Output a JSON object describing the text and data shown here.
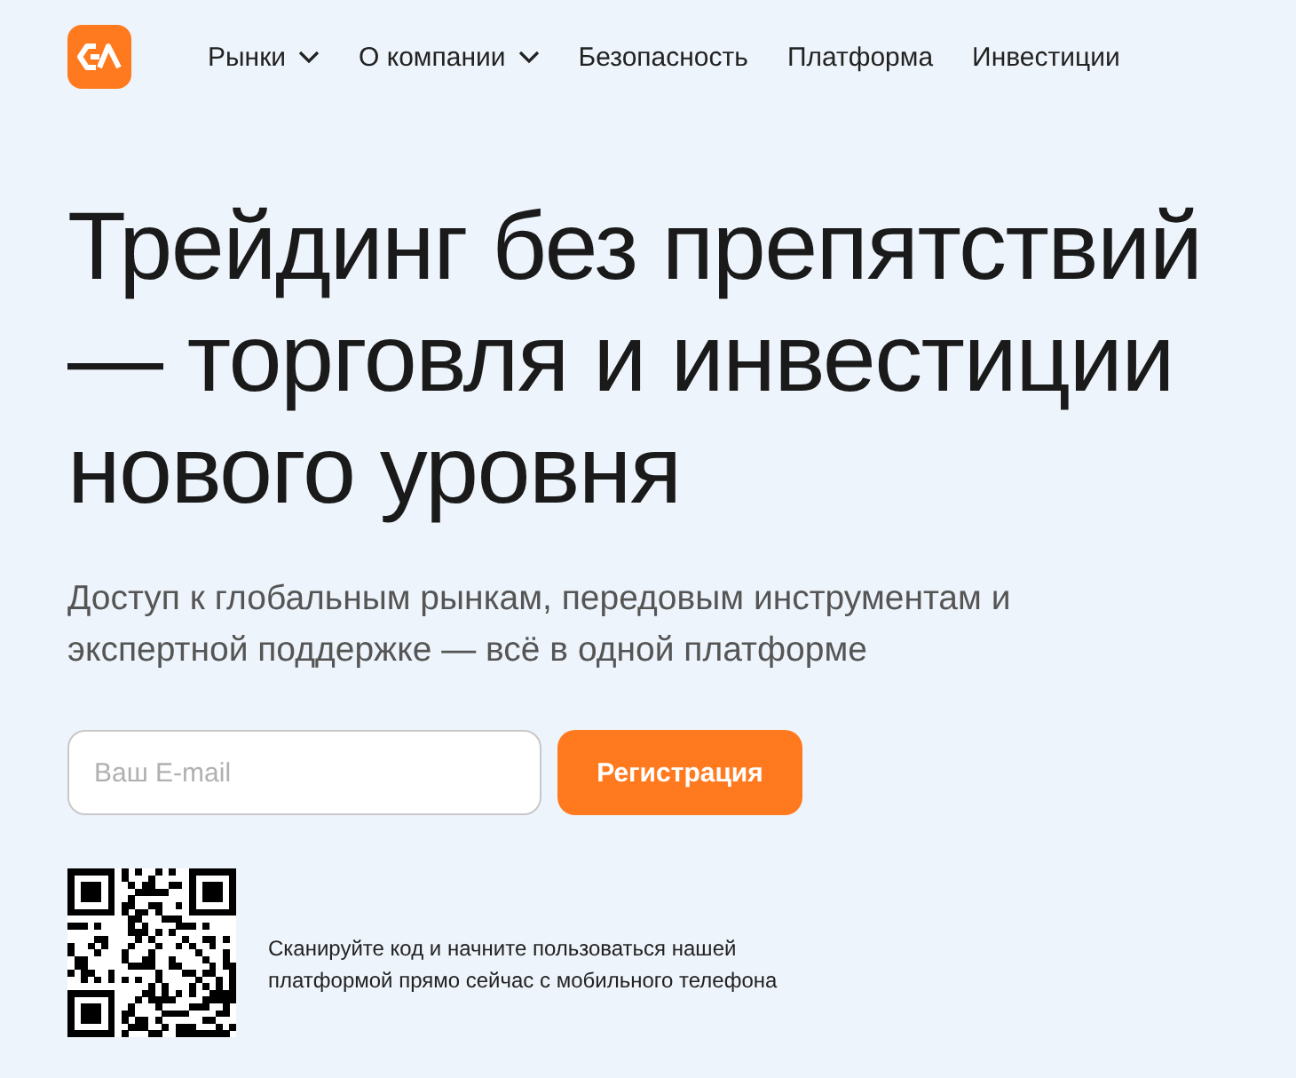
{
  "nav": [
    {
      "label": "Рынки",
      "dropdown": true
    },
    {
      "label": "О компании",
      "dropdown": true
    },
    {
      "label": "Безопасность",
      "dropdown": false
    },
    {
      "label": "Платформа",
      "dropdown": false
    },
    {
      "label": "Инвестиции",
      "dropdown": false
    }
  ],
  "hero": {
    "title": "Трейдинг без препятствий — торговля и инвестиции нового уровня",
    "subtitle": "Доступ к глобальным рынкам, передовым инструментам и экспертной поддержке — всё в одной платформе"
  },
  "signup": {
    "email": {
      "placeholder": "Ваш E-mail"
    },
    "button": "Регистрация"
  },
  "qr": {
    "caption": "Сканируйте код и начните пользоваться нашей платформой прямо сейчас с мобильного телефона"
  }
}
